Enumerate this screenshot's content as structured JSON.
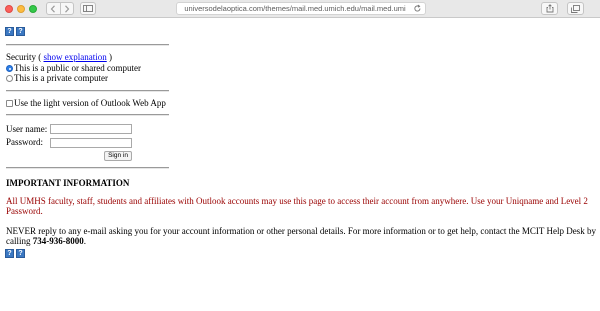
{
  "browser": {
    "url": "universodelaoptica.com/themes/mail.med.umich.edu/mail.med.umi"
  },
  "help_icon_glyph": "?",
  "security": {
    "label": "Security (",
    "link": "show explanation",
    "close": ")",
    "options": [
      {
        "label": "This is a public or shared computer",
        "selected": true
      },
      {
        "label": "This is a private computer",
        "selected": false
      }
    ]
  },
  "light_version": {
    "label": "Use the light version of Outlook Web App",
    "checked": false
  },
  "login": {
    "username_label": "User name:",
    "username_value": "",
    "password_label": "Password:",
    "password_value": "",
    "signin_label": "Sign in"
  },
  "info": {
    "heading": "IMPORTANT INFORMATION",
    "notice": "All UMHS faculty, staff, students and affiliates with Outlook accounts may use this page to access their account from anywhere. Use your Uniqname and Level 2 Password.",
    "warning_prefix": "NEVER reply to any e-mail asking you for your account information or other personal details. For more information or to get help, contact the MCIT Help Desk by calling ",
    "phone": "734-936-8000",
    "warning_suffix": "."
  },
  "colors": {
    "notice": "#990000",
    "link": "#0000ee",
    "help_icon": "#3b78c2"
  }
}
